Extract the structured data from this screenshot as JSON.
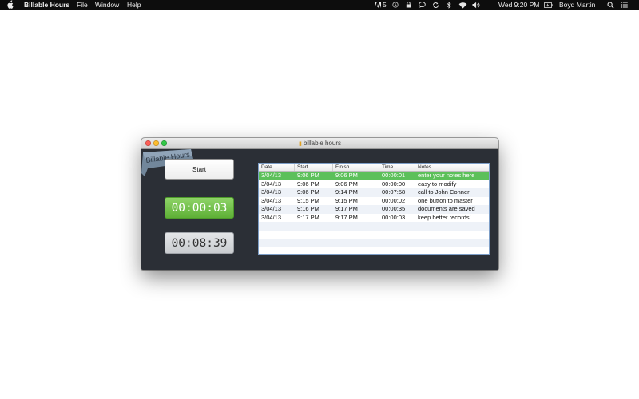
{
  "menubar": {
    "app_name": "Billable Hours",
    "menus": [
      "File",
      "Window",
      "Help"
    ],
    "adobe_badge": "5",
    "clock": "Wed 9:20 PM",
    "user": "Boyd Martin"
  },
  "window": {
    "title": "billable hours",
    "logo_text": "Billable Hours",
    "start_label": "Start",
    "current_timer": "00:00:03",
    "total_timer": "00:08:39"
  },
  "table": {
    "columns": [
      "Date",
      "Start",
      "Finish",
      "Time",
      "Notes"
    ],
    "rows": [
      {
        "date": "3/04/13",
        "start": "9:06 PM",
        "finish": "9:06 PM",
        "time": "00:00:01",
        "notes": "enter your notes here",
        "selected": true
      },
      {
        "date": "3/04/13",
        "start": "9:06 PM",
        "finish": "9:06 PM",
        "time": "00:00:00",
        "notes": "easy to modify"
      },
      {
        "date": "3/04/13",
        "start": "9:06 PM",
        "finish": "9:14 PM",
        "time": "00:07:58",
        "notes": "call to John Conner"
      },
      {
        "date": "3/04/13",
        "start": "9:15 PM",
        "finish": "9:15 PM",
        "time": "00:00:02",
        "notes": "one button to master"
      },
      {
        "date": "3/04/13",
        "start": "9:16 PM",
        "finish": "9:17 PM",
        "time": "00:00:35",
        "notes": "documents are saved"
      },
      {
        "date": "3/04/13",
        "start": "9:17 PM",
        "finish": "9:17 PM",
        "time": "00:00:03",
        "notes": "keep better records!"
      }
    ]
  },
  "colors": {
    "selected_row": "#5cc05a",
    "current_timer": "#6bbf3f",
    "window_bg": "#2b2f36"
  }
}
